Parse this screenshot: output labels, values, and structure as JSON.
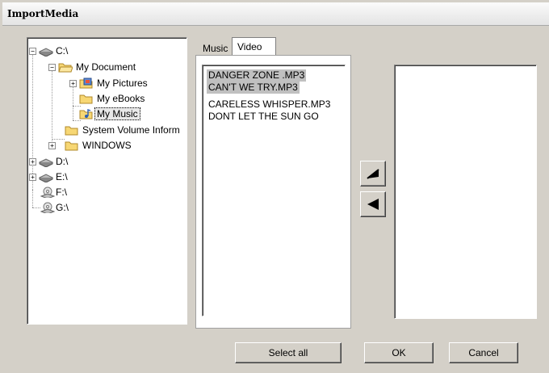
{
  "window": {
    "title": "ImportMedia"
  },
  "tree": {
    "items": [
      {
        "label": "C:\\",
        "toggle": "−",
        "icon": "hard-drive-icon"
      },
      {
        "label": "My Document",
        "toggle": "−",
        "icon": "folder-open-icon"
      },
      {
        "label": "My Pictures",
        "toggle": "+",
        "icon": "pictures-folder-icon"
      },
      {
        "label": "My eBooks",
        "toggle": "",
        "icon": "folder-icon"
      },
      {
        "label": "My Music",
        "toggle": "",
        "icon": "music-folder-icon",
        "selected": true
      },
      {
        "label": "System Volume Inform",
        "toggle": "",
        "icon": "folder-icon"
      },
      {
        "label": "WINDOWS",
        "toggle": "+",
        "icon": "folder-icon"
      },
      {
        "label": "D:\\",
        "toggle": "+",
        "icon": "hard-drive-icon"
      },
      {
        "label": "E:\\",
        "toggle": "+",
        "icon": "hard-drive-icon"
      },
      {
        "label": "F:\\",
        "toggle": "",
        "icon": "cd-drive-icon"
      },
      {
        "label": "G:\\",
        "toggle": "",
        "icon": "cd-drive-icon"
      }
    ]
  },
  "tabs": {
    "music": "Music",
    "video": "Video"
  },
  "files": [
    {
      "name": "DANGER ZONE .MP3",
      "selected": true
    },
    {
      "name": "CAN'T WE TRY.MP3",
      "selected": true
    },
    {
      "name": "CARELESS WHISPER.MP3",
      "selected": false
    },
    {
      "name": "DONT LET THE SUN GO",
      "selected": false
    }
  ],
  "buttons": {
    "select_all": "Select all",
    "ok": "OK",
    "cancel": "Cancel"
  },
  "icons": {
    "add": "right-arrow-icon",
    "remove": "left-arrow-icon"
  }
}
